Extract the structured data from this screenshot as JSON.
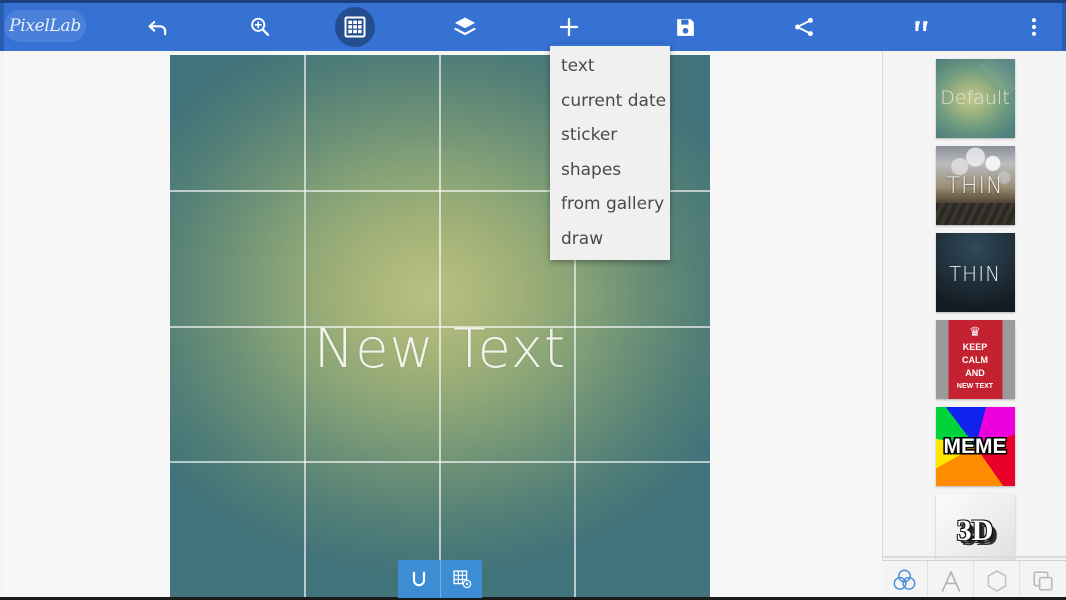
{
  "app": {
    "name": "PixelLab",
    "logo_text": "PixelLab"
  },
  "toolbar": {
    "items": [
      {
        "name": "undo",
        "label": "undo",
        "icon": "undo-icon",
        "active": false
      },
      {
        "name": "zoom",
        "label": "zoom",
        "icon": "magnifier-plus-icon",
        "active": false
      },
      {
        "name": "grid",
        "label": "grid",
        "icon": "grid-icon",
        "active": true
      },
      {
        "name": "layers",
        "label": "layers",
        "icon": "layers-icon",
        "active": false
      },
      {
        "name": "add",
        "label": "add",
        "icon": "plus-icon",
        "active": false
      },
      {
        "name": "save",
        "label": "save",
        "icon": "floppy-disk-icon",
        "active": false
      },
      {
        "name": "share",
        "label": "share",
        "icon": "share-icon",
        "active": false
      },
      {
        "name": "quote",
        "label": "quote",
        "icon": "quotation-mark-icon",
        "active": false
      },
      {
        "name": "overflow",
        "label": "more options",
        "icon": "kebab-menu-icon",
        "active": false
      }
    ],
    "accent_color": "#3672d4",
    "active_circle_color": "#244d8f"
  },
  "add_menu": {
    "open": true,
    "items": [
      {
        "label": "text"
      },
      {
        "label": "current date"
      },
      {
        "label": "sticker"
      },
      {
        "label": "shapes"
      },
      {
        "label": "from gallery"
      },
      {
        "label": "draw"
      }
    ]
  },
  "canvas": {
    "text": "New Text",
    "grid_visible": true,
    "grid_columns": 4,
    "grid_rows": 4,
    "background_colors": {
      "glow": "#b7c183",
      "mid": "#8aa577",
      "edge": "#42737a"
    },
    "floating_buttons": [
      {
        "name": "snap-magnet",
        "icon": "magnet-icon"
      },
      {
        "name": "grid-settings",
        "icon": "grid-settings-icon"
      }
    ]
  },
  "sidebar": {
    "presets": [
      {
        "name": "preset-default",
        "label": "Default",
        "style": "p-default"
      },
      {
        "name": "preset-thin-bokeh",
        "label": "THIN",
        "style": "p-bokeh"
      },
      {
        "name": "preset-thin-dark",
        "label": "THIN",
        "style": "p-dark"
      },
      {
        "name": "preset-keep-calm",
        "style": "p-keepcalm",
        "crown": "♛",
        "lines": [
          "KEEP",
          "CALM",
          "AND",
          "NEW TEXT"
        ]
      },
      {
        "name": "preset-meme",
        "label": "MEME",
        "style": "p-meme"
      },
      {
        "name": "preset-3d",
        "label": "3D",
        "style": "p-3d"
      }
    ],
    "bottom_tools": [
      {
        "name": "color-venn",
        "icon": "color-circles-icon",
        "active": true
      },
      {
        "name": "font",
        "icon": "letter-a-icon",
        "active": false
      },
      {
        "name": "shape",
        "icon": "hexagon-icon",
        "active": false
      },
      {
        "name": "duplicate",
        "icon": "copy-squares-icon",
        "active": false
      }
    ],
    "active_tool_color": "#4a90d9",
    "inactive_tool_color": "#b0b4b8"
  }
}
